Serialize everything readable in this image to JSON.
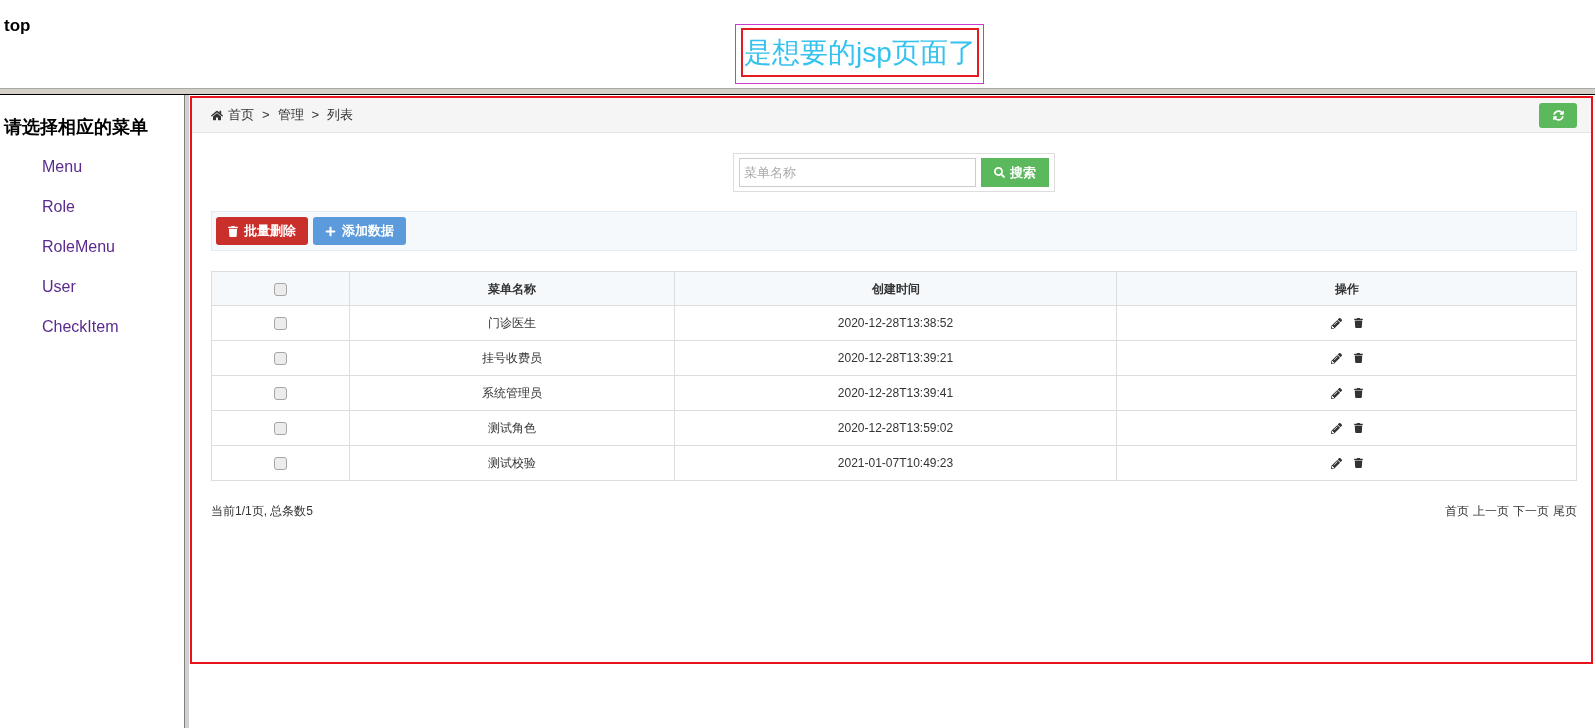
{
  "header": {
    "label": "top",
    "title": "是想要的jsp页面了"
  },
  "sidebar": {
    "heading": "请选择相应的菜单",
    "items": [
      {
        "label": "Menu"
      },
      {
        "label": "Role"
      },
      {
        "label": "RoleMenu"
      },
      {
        "label": "User"
      },
      {
        "label": "CheckItem"
      }
    ]
  },
  "breadcrumb": [
    {
      "kind": "home",
      "text": "首页"
    },
    {
      "kind": "separator",
      "text": ">"
    },
    {
      "kind": "link",
      "text": "管理"
    },
    {
      "kind": "separator",
      "text": ">"
    },
    {
      "kind": "link",
      "text": "列表"
    }
  ],
  "search": {
    "placeholder": "菜单名称",
    "button": "搜索"
  },
  "toolbar": {
    "buttons": [
      {
        "kind": "danger",
        "label": "批量删除"
      },
      {
        "kind": "primary",
        "label": "添加数据"
      }
    ]
  },
  "table": {
    "all_checked": false,
    "columns": [
      "菜单名称",
      "创建时间",
      "操作"
    ],
    "rows": [
      {
        "checked": false,
        "menu_name": "门诊医生",
        "created_at": "2020-12-28T13:38:52"
      },
      {
        "checked": false,
        "menu_name": "挂号收费员",
        "created_at": "2020-12-28T13:39:21"
      },
      {
        "checked": false,
        "menu_name": "系统管理员",
        "created_at": "2020-12-28T13:39:41"
      },
      {
        "checked": false,
        "menu_name": "测试角色",
        "created_at": "2020-12-28T13:59:02"
      },
      {
        "checked": false,
        "menu_name": "测试校验",
        "created_at": "2021-01-07T10:49:23"
      }
    ]
  },
  "pagination": {
    "summary": "当前1/1页, 总条数5",
    "links": [
      "首页",
      "上一页",
      "下一页",
      "尾页"
    ]
  }
}
